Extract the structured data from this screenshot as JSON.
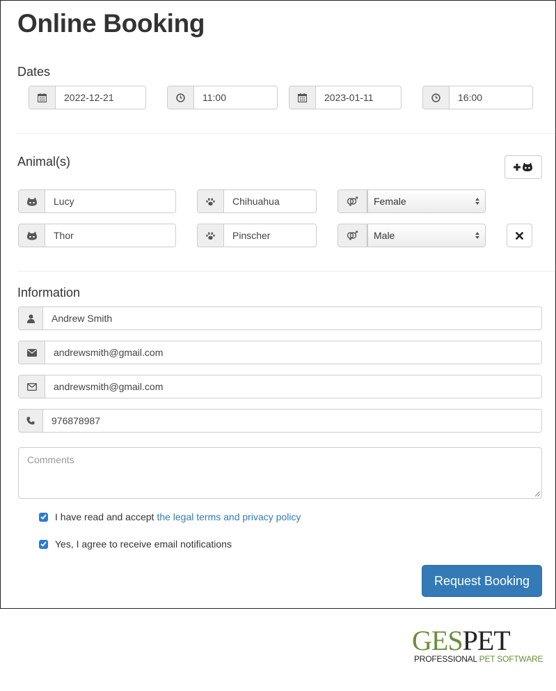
{
  "page": {
    "title": "Online Booking"
  },
  "dates": {
    "heading": "Dates",
    "start_date": "2022-12-21",
    "start_time": "11:00",
    "end_date": "2023-01-11",
    "end_time": "16:00"
  },
  "animals": {
    "heading": "Animal(s)",
    "add_button_icon": "plus-cat-icon",
    "items": [
      {
        "name": "Lucy",
        "breed": "Chihuahua",
        "sex": "Female",
        "removable": false
      },
      {
        "name": "Thor",
        "breed": "Pinscher",
        "sex": "Male",
        "removable": true
      }
    ]
  },
  "information": {
    "heading": "Information",
    "name": "Andrew Smith",
    "email": "andrewsmith@gmail.com",
    "email_confirm": "andrewsmith@gmail.com",
    "phone": "976878987",
    "comments_placeholder": "Comments"
  },
  "consents": {
    "terms_text": "I have read and accept",
    "terms_link": "the legal terms and privacy policy",
    "terms_checked": true,
    "notifications_text": "Yes, I agree to receive email notifications",
    "notifications_checked": true
  },
  "actions": {
    "submit_label": "Request Booking"
  },
  "brand": {
    "logo_ges": "GES",
    "logo_pet": "PET",
    "tagline_1": "PROFESSIONAL ",
    "tagline_2": "PET SOFTWARE",
    "color_green": "#6b8e3a",
    "color_dark": "#222222"
  },
  "colors": {
    "primary": "#337ab7",
    "addon_bg": "#eeeeee",
    "border": "#cccccc"
  }
}
